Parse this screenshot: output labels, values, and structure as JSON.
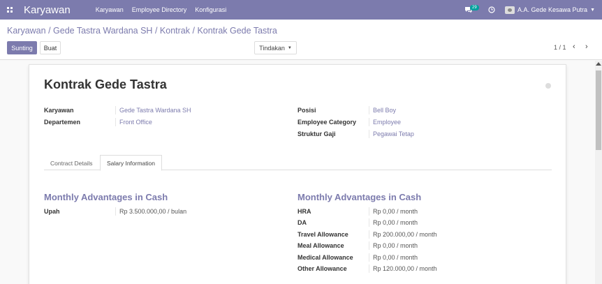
{
  "topbar": {
    "brand": "Karyawan",
    "menu": [
      "Karyawan",
      "Employee Directory",
      "Konfigurasi"
    ],
    "chat_count": "29",
    "user_name": "A.A. Gede Kesawa Putra"
  },
  "control": {
    "breadcrumb": [
      "Karyawan",
      "Gede Tastra Wardana SH",
      "Kontrak",
      "Kontrak Gede Tastra"
    ],
    "edit_label": "Sunting",
    "create_label": "Buat",
    "action_label": "Tindakan",
    "pager": "1 / 1"
  },
  "form": {
    "title": "Kontrak Gede Tastra",
    "left_fields": [
      {
        "label": "Karyawan",
        "value": "Gede Tastra Wardana SH"
      },
      {
        "label": "Departemen",
        "value": "Front Office"
      }
    ],
    "right_fields": [
      {
        "label": "Posisi",
        "value": "Bell Boy"
      },
      {
        "label": "Employee Category",
        "value": "Employee"
      },
      {
        "label": "Struktur Gaji",
        "value": "Pegawai Tetap"
      }
    ],
    "tabs": [
      "Contract Details",
      "Salary Information"
    ],
    "left_section": {
      "title": "Monthly Advantages in Cash",
      "rows": [
        {
          "label": "Upah",
          "value": "Rp 3.500.000,00 / bulan"
        }
      ]
    },
    "right_section": {
      "title": "Monthly Advantages in Cash",
      "rows": [
        {
          "label": "HRA",
          "value": "Rp 0,00 / month"
        },
        {
          "label": "DA",
          "value": "Rp 0,00 / month"
        },
        {
          "label": "Travel Allowance",
          "value": "Rp 200.000,00 / month"
        },
        {
          "label": "Meal Allowance",
          "value": "Rp 0,00 / month"
        },
        {
          "label": "Medical Allowance",
          "value": "Rp 0,00 / month"
        },
        {
          "label": "Other Allowance",
          "value": "Rp 120.000,00 / month"
        }
      ]
    }
  }
}
